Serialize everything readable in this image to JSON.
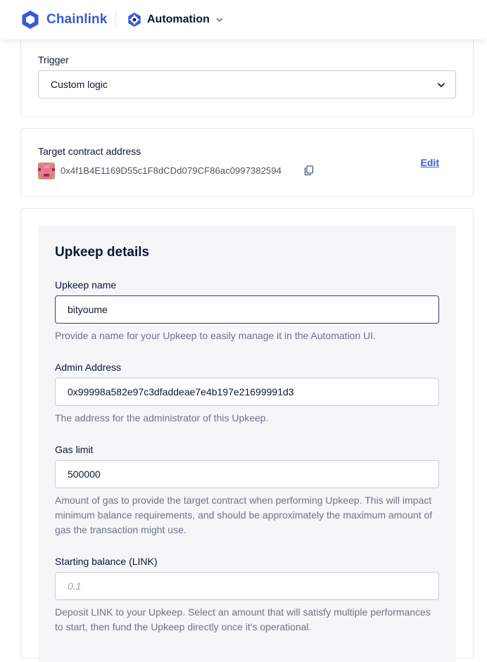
{
  "header": {
    "brand_name": "Chainlink",
    "product_name": "Automation",
    "colors": {
      "brand": "#375bd2",
      "text": "#0c1635"
    }
  },
  "trigger": {
    "label": "Trigger",
    "selected": "Custom logic"
  },
  "target_contract": {
    "label": "Target contract address",
    "address": "0x4f1B4E1169D55c1F8dCDd079CF86ac0997382594",
    "edit_label": "Edit"
  },
  "upkeep": {
    "title": "Upkeep details",
    "name": {
      "label": "Upkeep name",
      "value": "bityoume",
      "helper": "Provide a name for your Upkeep to easily manage it in the Automation UI."
    },
    "admin": {
      "label": "Admin Address",
      "value": "0x99998a582e97c3dfaddeae7e4b197e21699991d3",
      "helper": "The address for the administrator of this Upkeep."
    },
    "gas": {
      "label": "Gas limit",
      "value": "500000",
      "helper": "Amount of gas to provide the target contract when performing Upkeep. This will impact minimum balance requirements, and should be approximately the maximum amount of gas the transaction might use."
    },
    "balance": {
      "label": "Starting balance (LINK)",
      "placeholder": "0.1",
      "helper": "Deposit LINK to your Upkeep. Select an amount that will satisfy multiple performances to start, then fund the Upkeep directly once it's operational."
    }
  }
}
